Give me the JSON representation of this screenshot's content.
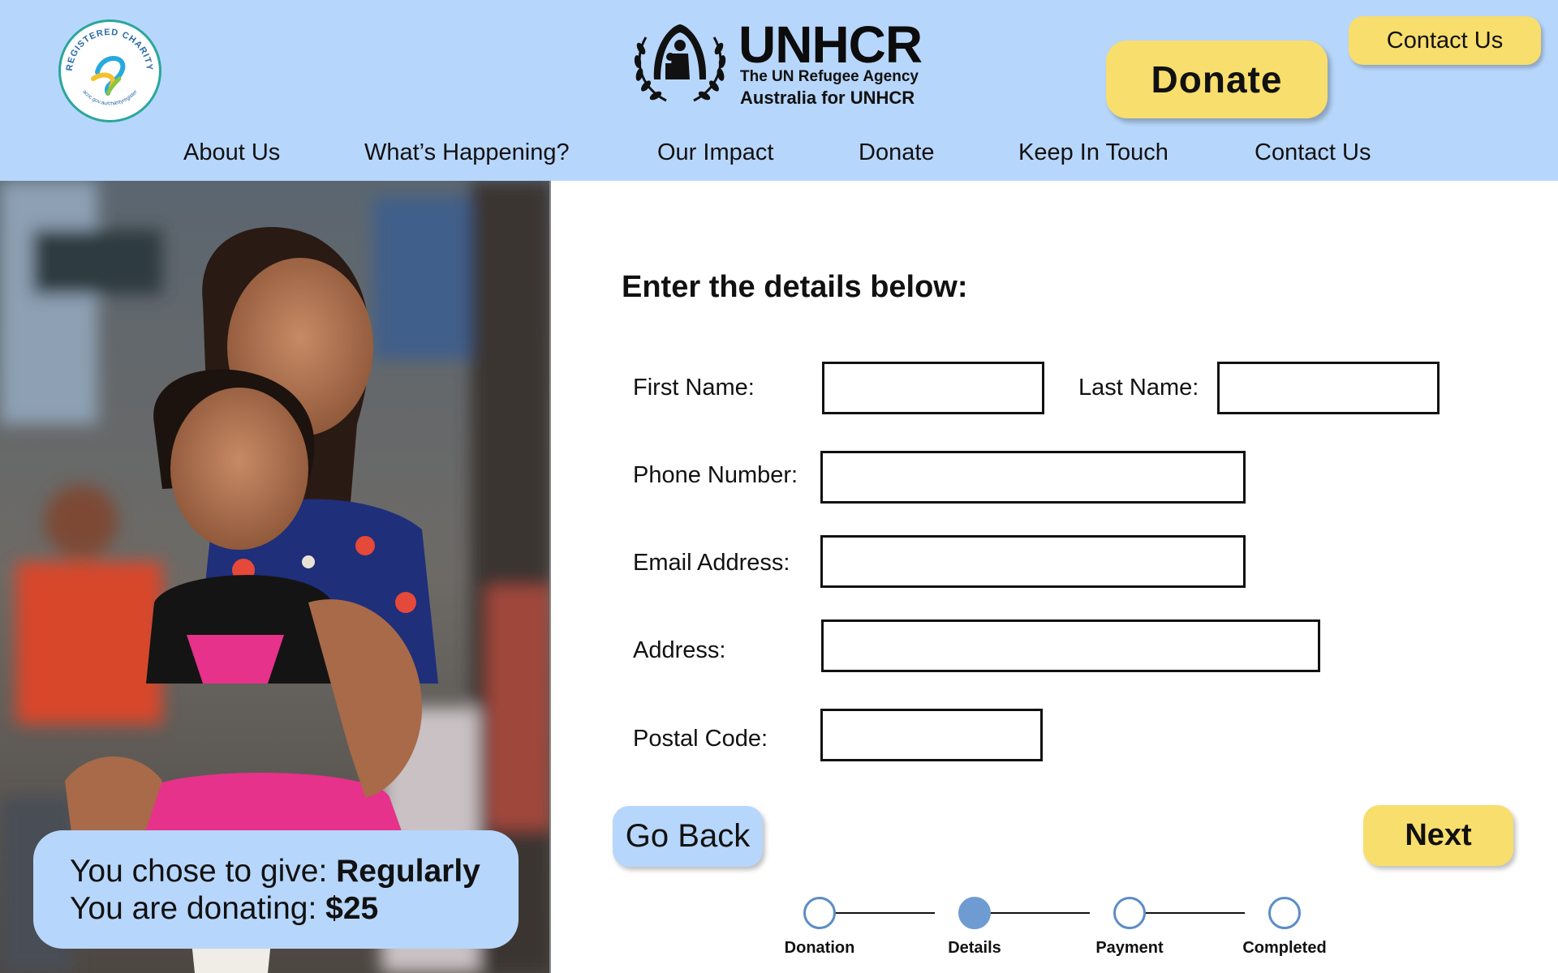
{
  "header": {
    "charity_badge_text": "REGISTERED CHARITY",
    "charity_badge_url": "acnc.gov.au/charityregister",
    "logo_name": "UNHCR",
    "logo_sub1": "The UN Refugee Agency",
    "logo_sub2": "Australia for UNHCR",
    "donate_button": "Donate",
    "contact_button": "Contact Us"
  },
  "nav": {
    "items": [
      "About Us",
      "What’s Happening?",
      "Our Impact",
      "Donate",
      "Keep In Touch",
      "Contact Us"
    ]
  },
  "summary": {
    "give_prefix": "You chose to give: ",
    "give_value": "Regularly",
    "amount_prefix": "You are donating: ",
    "amount_value": "$25"
  },
  "form": {
    "title": "Enter the details below:",
    "first_name_label": "First Name:",
    "first_name_value": "",
    "last_name_label": "Last Name:",
    "last_name_value": "",
    "phone_label": "Phone Number:",
    "phone_value": "",
    "email_label": "Email Address:",
    "email_value": "",
    "address_label": "Address:",
    "address_value": "",
    "postal_label": "Postal Code:",
    "postal_value": ""
  },
  "actions": {
    "back": "Go Back",
    "next": "Next"
  },
  "stepper": {
    "steps": [
      "Donation",
      "Details",
      "Payment",
      "Completed"
    ],
    "current_step": 2
  },
  "colors": {
    "header_bg": "#b7d6fb",
    "accent_yellow": "#f8de6c",
    "step_active": "#6f9bd3"
  }
}
